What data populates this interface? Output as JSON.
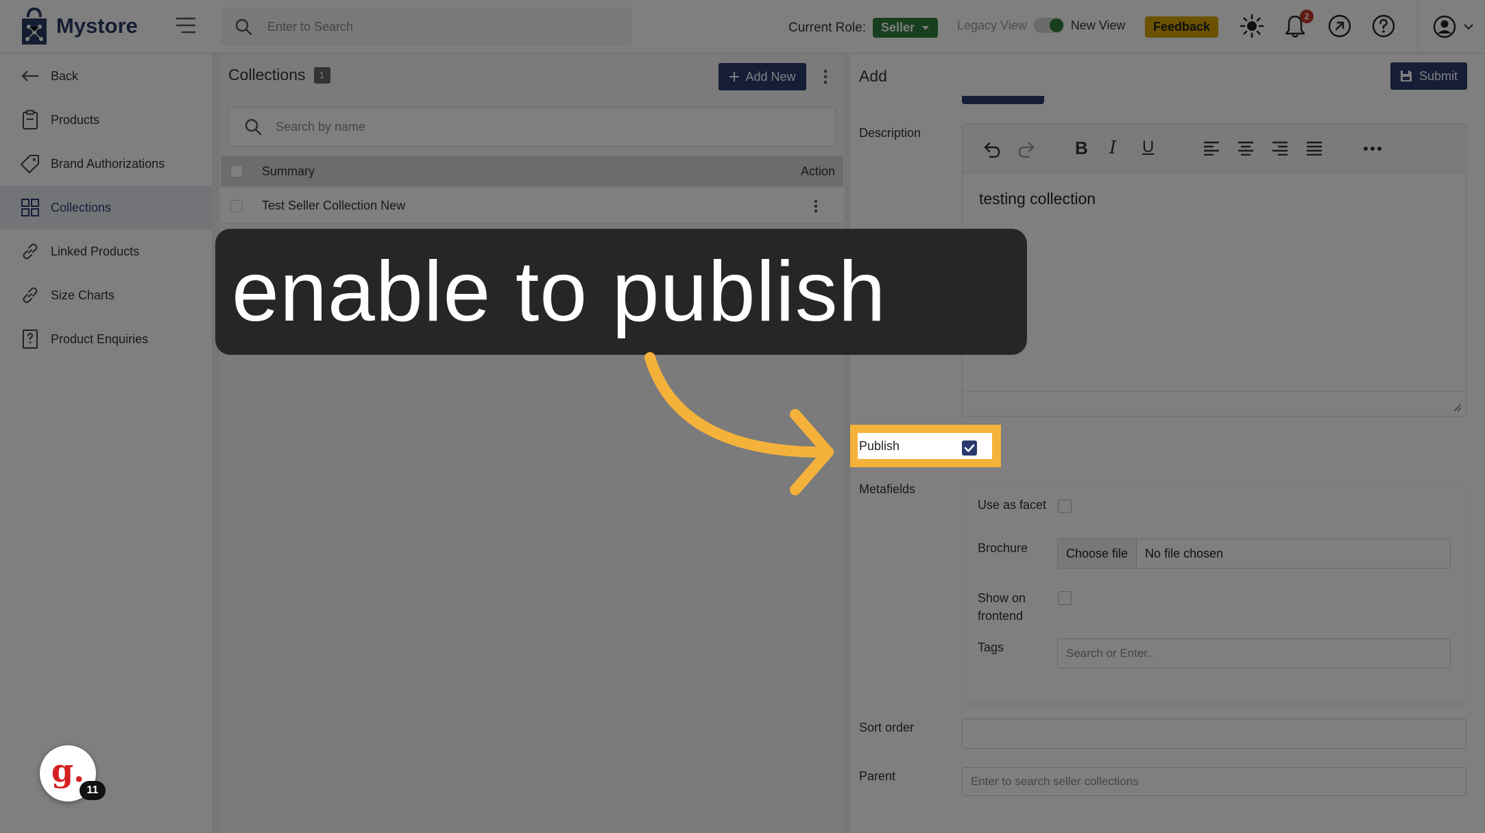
{
  "app": {
    "name": "Mystore"
  },
  "topbar": {
    "search_placeholder": "Enter to Search",
    "role_label": "Current Role:",
    "role_value": "Seller",
    "legacy_view": "Legacy View",
    "new_view": "New View",
    "feedback": "Feedback",
    "notification_count": "2",
    "accent_color": "#2f7d3a"
  },
  "sidebar": {
    "items": [
      {
        "label": "Back",
        "icon": "arrow-left-icon"
      },
      {
        "label": "Products",
        "icon": "clipboard-icon"
      },
      {
        "label": "Brand Authorizations",
        "icon": "tag-icon"
      },
      {
        "label": "Collections",
        "icon": "grid-icon",
        "active": true
      },
      {
        "label": "Linked Products",
        "icon": "link-icon"
      },
      {
        "label": "Size Charts",
        "icon": "link-icon"
      },
      {
        "label": "Product Enquiries",
        "icon": "question-doc-icon"
      }
    ]
  },
  "collections": {
    "title": "Collections",
    "count": "1",
    "add_new": "Add New",
    "search_placeholder": "Search by name",
    "columns": {
      "summary": "Summary",
      "action": "Action"
    },
    "rows": [
      {
        "summary": "Test Seller Collection New"
      }
    ]
  },
  "form": {
    "title": "Add",
    "submit": "Submit",
    "description_label": "Description",
    "description_text": "testing collection",
    "publish_label": "Publish",
    "publish_checked": true,
    "metafields_label": "Metafields",
    "use_as_facet": "Use as facet",
    "brochure": "Brochure",
    "choose_file": "Choose file",
    "no_file": "No file chosen",
    "show_on_frontend_1": "Show on",
    "show_on_frontend_2": "frontend",
    "tags": "Tags",
    "tags_placeholder": "Search or Enter..",
    "sort_order": "Sort order",
    "parent": "Parent",
    "parent_placeholder": "Enter to search seller collections"
  },
  "overlay": {
    "callout_text": "enable to publish",
    "highlight_color": "#f5b23b",
    "guide_count": "11",
    "guide_letter": "g."
  }
}
